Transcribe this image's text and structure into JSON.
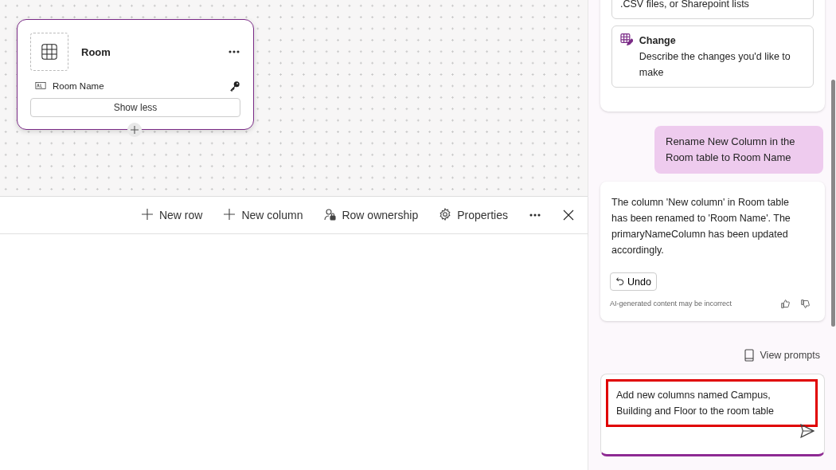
{
  "table_card": {
    "title": "Room",
    "columns": [
      {
        "name": "Room Name",
        "primary_key": true
      }
    ],
    "toggle_button": "Show less"
  },
  "toolbar": {
    "buttons": [
      {
        "label": "New row",
        "kind": "plus"
      },
      {
        "label": "New column",
        "kind": "plus"
      },
      {
        "label": "Row ownership",
        "kind": "owner"
      },
      {
        "label": "Properties",
        "kind": "gear"
      }
    ]
  },
  "copilot": {
    "suggestions": [
      {
        "description": ".CSV files, or Sharepoint lists"
      },
      {
        "title": "Change",
        "description": "Describe the changes you'd like to make"
      }
    ],
    "messages": [
      {
        "kind": "user",
        "text": "Rename New Column in the Room table to Room Name"
      },
      {
        "kind": "assistant",
        "text": "The column 'New column' in Room table has been renamed to 'Room Name'. The primaryNameColumn has been updated accordingly.",
        "undo": "Undo",
        "disclaimer": "AI-generated content may be incorrect"
      }
    ],
    "view_prompts": "View prompts",
    "input": {
      "value": "Add new columns named Campus, Building and Floor to the room table"
    }
  }
}
